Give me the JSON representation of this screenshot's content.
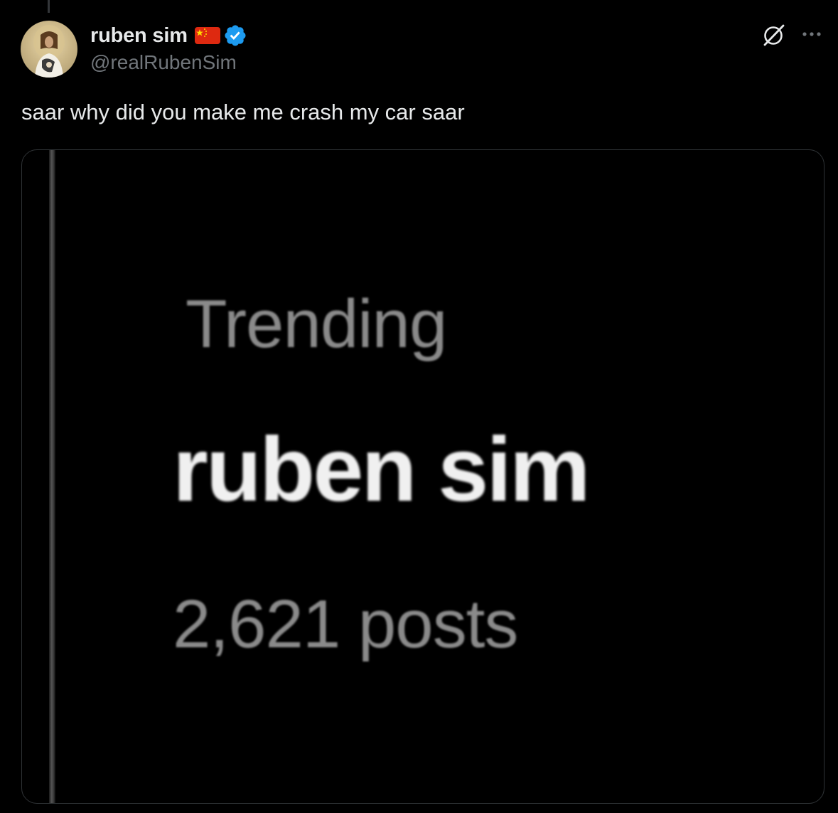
{
  "post": {
    "author": {
      "display_name": "ruben sim",
      "handle": "@realRubenSim",
      "flag_icon": "china-flag-icon",
      "verified_icon": "verified-badge-icon",
      "verified_color": "#1d9bf0"
    },
    "text": "saar why did you make me crash my car saar",
    "actions": {
      "grok_icon": "grok-icon",
      "more_icon": "more-icon"
    },
    "media": {
      "trending_label": "Trending",
      "trending_topic": "ruben sim",
      "post_count": "2,621 posts"
    }
  },
  "colors": {
    "background": "#000000",
    "text_primary": "#e7e9ea",
    "text_secondary": "#71767b",
    "border": "#2f3336"
  }
}
